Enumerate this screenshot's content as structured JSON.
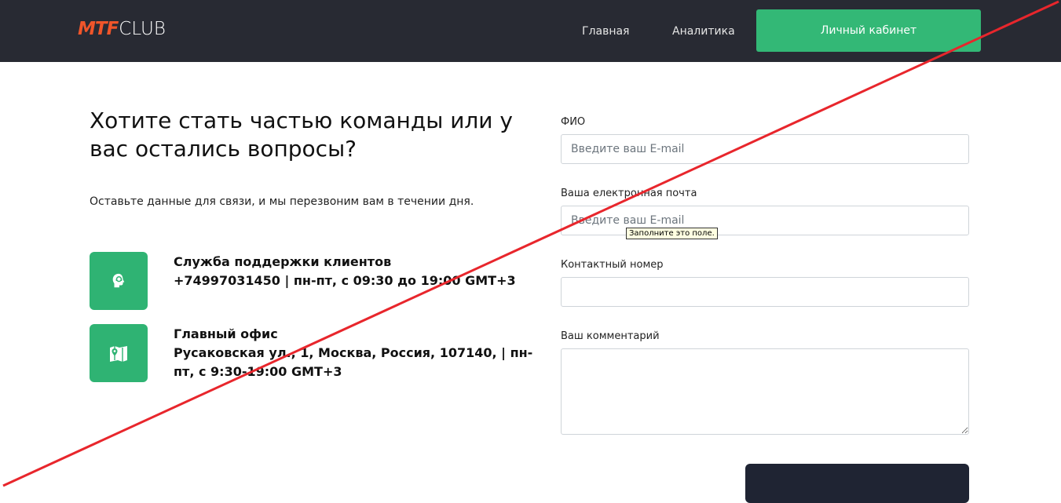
{
  "header": {
    "logo_mtf": "MTF",
    "logo_club": "CLUB",
    "nav": {
      "main": "Главная",
      "analytics": "Аналитика",
      "cabinet": "Личный кабинет"
    }
  },
  "intro": {
    "title": "Хотите стать частью команды или у вас остались вопросы?",
    "subtitle": "Оставьте данные для связи, и мы перезвоним вам в течении дня."
  },
  "contacts": {
    "support": {
      "title": "Служба поддержки клиентов",
      "details": "+74997031450 | пн-пт, с 09:30 до 19:00 GMT+3",
      "icon": "support-headset-icon"
    },
    "office": {
      "title": "Главный офис",
      "details": "Русаковская ул., 1, Москва, Россия, 107140, | пн-пт, с 9:30-19:00 GMT+3",
      "icon": "map-pin-icon"
    }
  },
  "form": {
    "name_label": "ФИО",
    "name_placeholder": "Введите ваш E-mail",
    "email_label": "Ваша електронная почта",
    "email_placeholder": "Введите ваш E-mail",
    "email_tooltip": "Заполните это поле.",
    "phone_label": "Контактный номер",
    "phone_placeholder": "",
    "comment_label": "Ваш комментарий",
    "comment_placeholder": ""
  },
  "colors": {
    "header_bg": "#282a33",
    "accent_green": "#33b876",
    "logo_orange": "#f0552a",
    "cross_red": "#e8262c"
  }
}
